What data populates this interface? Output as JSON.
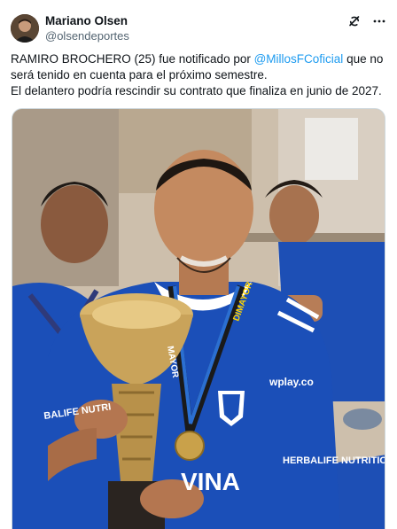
{
  "author": {
    "name": "Mariano Olsen",
    "handle": "@olsendeportes"
  },
  "actions": {
    "grok_icon": "grok-icon",
    "more_icon": "more-icon"
  },
  "post": {
    "line1_pre": "RAMIRO BROCHERO (25) fue notificado por ",
    "mention": "@MillosFCoficial",
    "line1_post": " que no será tenido en cuenta para el próximo semestre.",
    "line2": "El delantero podría rescindir su contrato que finaliza en junio de 2027."
  },
  "media": {
    "jersey_sponsor": "wplay.co",
    "jersey_brand": "HERBALIFE NUTRITION",
    "sleeve_text": "BALIFE NUTRI",
    "lanyard_text": "MAYOR",
    "lanyard_text2": "DIMAYOR",
    "shirt_front_text": "VINA",
    "colors": {
      "mention": "#1d9bf0",
      "jersey": "#1b4fb8"
    }
  }
}
